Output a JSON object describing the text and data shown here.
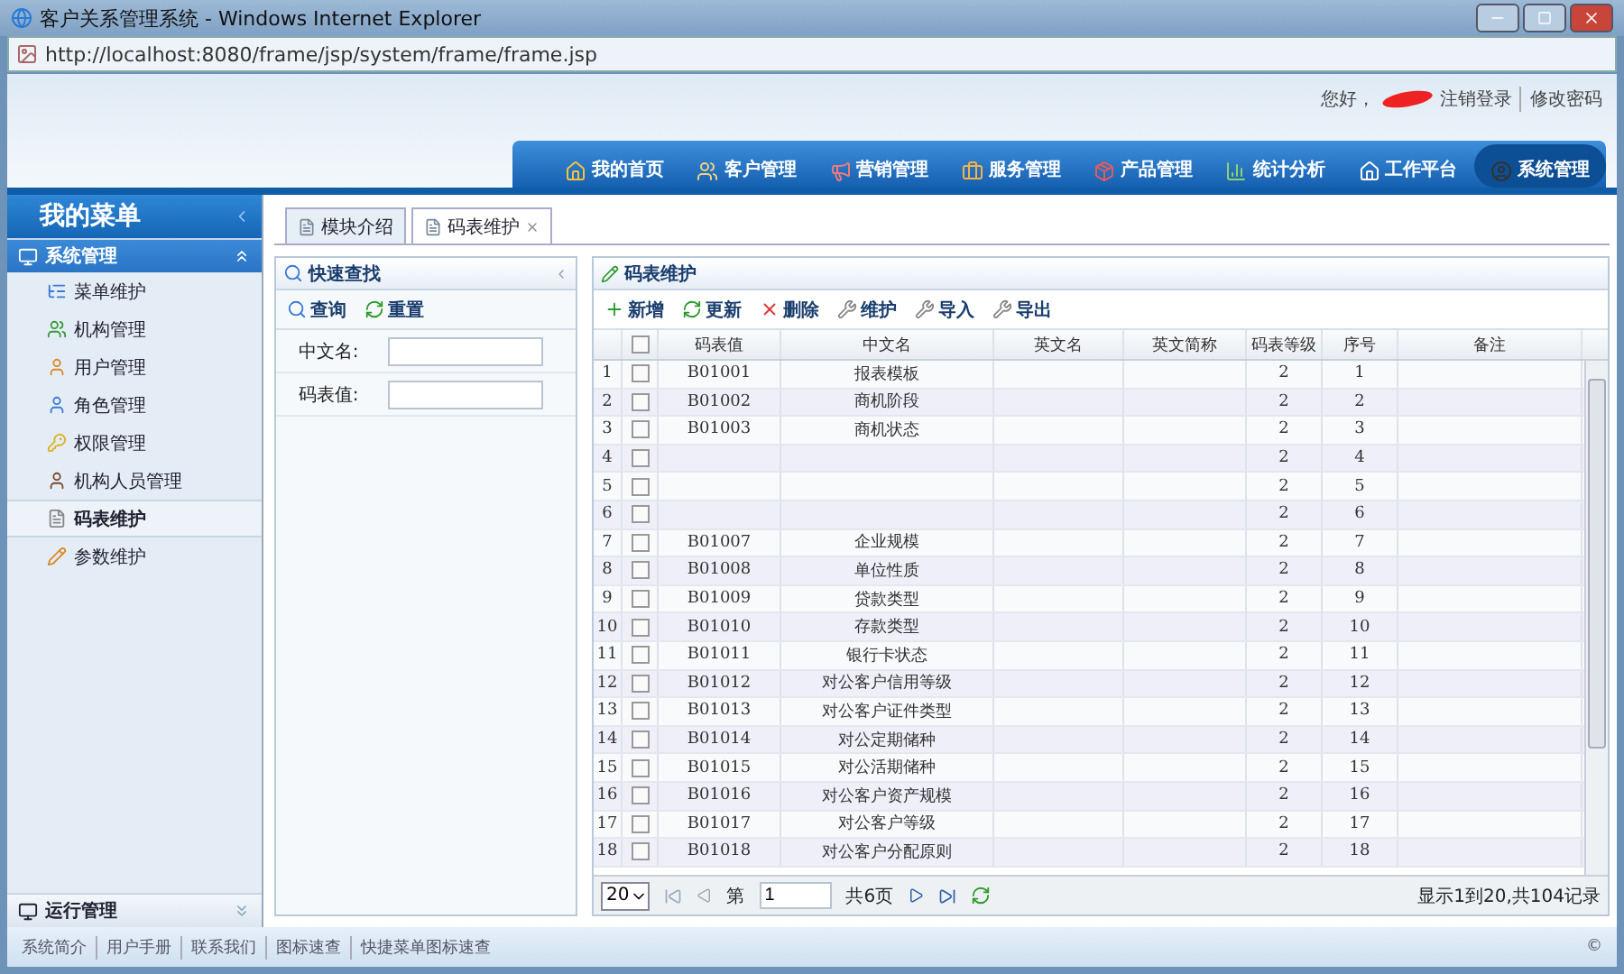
{
  "window": {
    "title": "客户关系管理系统 - Windows Internet Explorer",
    "address": "http://localhost:8080/frame/jsp/system/frame/frame.jsp"
  },
  "header": {
    "greeting": "您好，",
    "links": [
      "注销登录",
      "修改密码"
    ]
  },
  "nav": [
    {
      "label": "我的首页",
      "selected": false
    },
    {
      "label": "客户管理",
      "selected": false
    },
    {
      "label": "营销管理",
      "selected": false
    },
    {
      "label": "服务管理",
      "selected": false
    },
    {
      "label": "产品管理",
      "selected": false
    },
    {
      "label": "统计分析",
      "selected": false
    },
    {
      "label": "工作平台",
      "selected": false
    },
    {
      "label": "系统管理",
      "selected": true
    }
  ],
  "sidebar": {
    "title": "我的菜单",
    "sections": [
      {
        "label": "系统管理",
        "expanded": true,
        "items": [
          {
            "label": "菜单维护",
            "selected": false
          },
          {
            "label": "机构管理",
            "selected": false
          },
          {
            "label": "用户管理",
            "selected": false
          },
          {
            "label": "角色管理",
            "selected": false
          },
          {
            "label": "权限管理",
            "selected": false
          },
          {
            "label": "机构人员管理",
            "selected": false
          },
          {
            "label": "码表维护",
            "selected": true
          },
          {
            "label": "参数维护",
            "selected": false
          }
        ]
      },
      {
        "label": "运行管理",
        "expanded": false
      }
    ]
  },
  "tabs": [
    {
      "label": "模块介绍",
      "selected": false,
      "closable": false
    },
    {
      "label": "码表维护",
      "selected": true,
      "closable": true
    }
  ],
  "search_panel": {
    "title": "快速查找",
    "buttons": [
      "查询",
      "重置"
    ],
    "fields": [
      {
        "label": "中文名:"
      },
      {
        "label": "码表值:"
      }
    ]
  },
  "grid": {
    "title": "码表维护",
    "toolbar": [
      "新增",
      "更新",
      "删除",
      "维护",
      "导入",
      "导出"
    ],
    "all_checked": false,
    "columns": [
      "码表值",
      "中文名",
      "英文名",
      "英文简称",
      "码表等级",
      "序号",
      "备注"
    ],
    "rows": [
      {
        "n": "1",
        "code": "B01001",
        "name": "报表模板",
        "level": "2",
        "seq": "1",
        "checked": false
      },
      {
        "n": "2",
        "code": "B01002",
        "name": "商机阶段",
        "level": "2",
        "seq": "2",
        "checked": false
      },
      {
        "n": "3",
        "code": "B01003",
        "name": "商机状态",
        "level": "2",
        "seq": "3",
        "checked": false
      },
      {
        "n": "4",
        "level": "2",
        "seq": "4",
        "checked": false
      },
      {
        "n": "5",
        "level": "2",
        "seq": "5",
        "checked": false
      },
      {
        "n": "6",
        "level": "2",
        "seq": "6",
        "checked": false
      },
      {
        "n": "7",
        "code": "B01007",
        "name": "企业规模",
        "level": "2",
        "seq": "7",
        "checked": false
      },
      {
        "n": "8",
        "code": "B01008",
        "name": "单位性质",
        "level": "2",
        "seq": "8",
        "checked": false
      },
      {
        "n": "9",
        "code": "B01009",
        "name": "贷款类型",
        "level": "2",
        "seq": "9",
        "checked": false
      },
      {
        "n": "10",
        "code": "B01010",
        "name": "存款类型",
        "level": "2",
        "seq": "10",
        "checked": false
      },
      {
        "n": "11",
        "code": "B01011",
        "name": "银行卡状态",
        "level": "2",
        "seq": "11",
        "checked": false
      },
      {
        "n": "12",
        "code": "B01012",
        "name": "对公客户信用等级",
        "level": "2",
        "seq": "12",
        "checked": false
      },
      {
        "n": "13",
        "code": "B01013",
        "name": "对公客户证件类型",
        "level": "2",
        "seq": "13",
        "checked": false
      },
      {
        "n": "14",
        "code": "B01014",
        "name": "对公定期储种",
        "level": "2",
        "seq": "14",
        "checked": false
      },
      {
        "n": "15",
        "code": "B01015",
        "name": "对公活期储种",
        "level": "2",
        "seq": "15",
        "checked": false
      },
      {
        "n": "16",
        "code": "B01016",
        "name": "对公客户资产规模",
        "level": "2",
        "seq": "16",
        "checked": false
      },
      {
        "n": "17",
        "code": "B01017",
        "name": "对公客户等级",
        "level": "2",
        "seq": "17",
        "checked": false
      },
      {
        "n": "18",
        "code": "B01018",
        "name": "对公客户分配原则",
        "level": "2",
        "seq": "18",
        "checked": false
      }
    ],
    "pager": {
      "page_size": "20",
      "page_prefix": "第",
      "page": "1",
      "total_pages": "共6页",
      "summary": "显示1到20,共104记录"
    }
  },
  "footer": {
    "links": [
      "系统简介",
      "用户手册",
      "联系我们",
      "图标速查",
      "快捷菜单图标速查"
    ],
    "copyright": "©"
  }
}
